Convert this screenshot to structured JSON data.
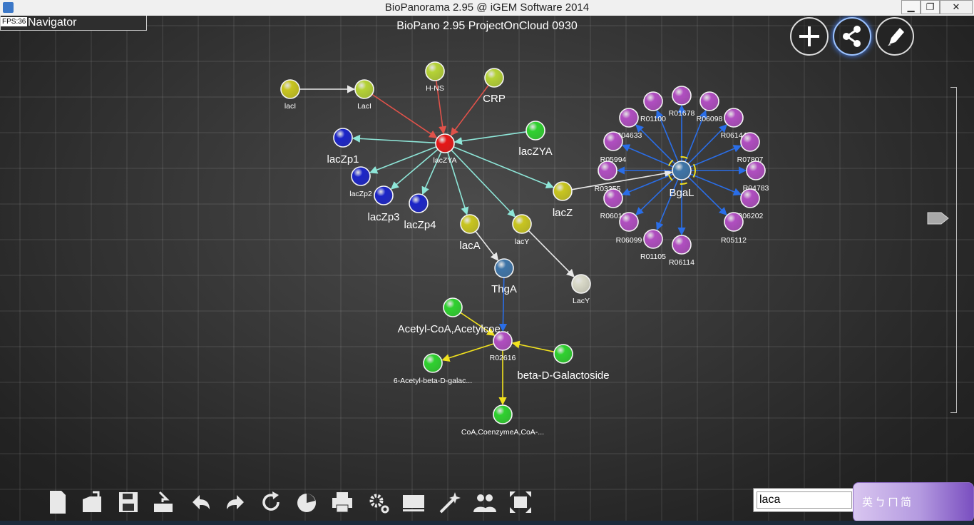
{
  "window": {
    "title": "BioPanorama 2.95 @ iGEM Software 2014",
    "minimize": "▁",
    "maximize": "❐",
    "close": "✕"
  },
  "navigator": {
    "label": "Navigator",
    "fps": "FPS:36"
  },
  "project": {
    "title": "BioPano 2.95 ProjectOnCloud 0930"
  },
  "top_buttons": [
    {
      "name": "add-button",
      "icon": "plus-icon"
    },
    {
      "name": "share-button",
      "icon": "share-icon"
    },
    {
      "name": "edit-button",
      "icon": "pencil-icon"
    }
  ],
  "colors": {
    "yellow_node": "#c8c520",
    "lime_node": "#b5d236",
    "green_node": "#2fd12f",
    "blue_node": "#1c25c8",
    "red_node": "#e61616",
    "purple_node": "#b04ec0",
    "steel_node": "#3f75a8",
    "white_node": "#d9d9c8",
    "red_edge": "#e0524a",
    "teal_edge": "#8ee6d8",
    "blue_edge": "#2a6ee8",
    "yellow_edge": "#f2e21e",
    "white_edge": "#e8e8e8"
  },
  "nodes": [
    {
      "id": "lacI_1",
      "label": "lacI",
      "color": "yellow"
    },
    {
      "id": "LacI",
      "label": "LacI",
      "color": "lime"
    },
    {
      "id": "HNS",
      "label": "H-NS",
      "color": "lime"
    },
    {
      "id": "CRP",
      "label": "CRP",
      "color": "lime"
    },
    {
      "id": "lacZp1",
      "label": "lacZp1",
      "color": "blue"
    },
    {
      "id": "lacZYA",
      "label": "lacZYA",
      "color": "red"
    },
    {
      "id": "lacZYA2",
      "label": "lacZYA",
      "color": "green"
    },
    {
      "id": "lacZp2",
      "label": "lacZp2",
      "color": "blue"
    },
    {
      "id": "lacZp3",
      "label": "lacZp3",
      "color": "blue"
    },
    {
      "id": "lacZp4",
      "label": "lacZp4",
      "color": "blue"
    },
    {
      "id": "lacA",
      "label": "lacA",
      "color": "yellow"
    },
    {
      "id": "lacY",
      "label": "lacY",
      "color": "yellow"
    },
    {
      "id": "lacZ",
      "label": "lacZ",
      "color": "yellow"
    },
    {
      "id": "ThgA",
      "label": "ThgA",
      "color": "steel"
    },
    {
      "id": "LacY2",
      "label": "LacY",
      "color": "white"
    },
    {
      "id": "acetylcoa",
      "label": "Acetyl-CoA,Acetylcoe...",
      "color": "green"
    },
    {
      "id": "R02616",
      "label": "R02616",
      "color": "purple"
    },
    {
      "id": "acetylgal",
      "label": "6-Acetyl-beta-D-galac...",
      "color": "green"
    },
    {
      "id": "bdgal",
      "label": "beta-D-Galactoside",
      "color": "green"
    },
    {
      "id": "coa",
      "label": "CoA,CoenzymeA,CoA-...",
      "color": "green"
    },
    {
      "id": "BgaL",
      "label": "BgaL",
      "color": "steel"
    },
    {
      "id": "R01678",
      "label": "R01678",
      "color": "purple"
    },
    {
      "id": "R01100",
      "label": "R01100",
      "color": "purple"
    },
    {
      "id": "R06098",
      "label": "R06098",
      "color": "purple"
    },
    {
      "id": "R04633",
      "label": "R04633",
      "color": "purple"
    },
    {
      "id": "R06144",
      "label": "R06144",
      "color": "purple"
    },
    {
      "id": "R05994",
      "label": "R05994",
      "color": "purple"
    },
    {
      "id": "R07807",
      "label": "R07807",
      "color": "purple"
    },
    {
      "id": "R03355",
      "label": "R03355",
      "color": "purple"
    },
    {
      "id": "R04783",
      "label": "R04783",
      "color": "purple"
    },
    {
      "id": "R06010",
      "label": "R06010",
      "color": "purple"
    },
    {
      "id": "R06202",
      "label": "R06202",
      "color": "purple"
    },
    {
      "id": "R06099",
      "label": "R06099",
      "color": "purple"
    },
    {
      "id": "R05112",
      "label": "R05112",
      "color": "purple"
    },
    {
      "id": "R01105",
      "label": "R01105",
      "color": "purple"
    },
    {
      "id": "R06114",
      "label": "R06114",
      "color": "purple"
    }
  ],
  "edges": [
    {
      "from": "lacI_1",
      "to": "LacI",
      "color": "white"
    },
    {
      "from": "LacI",
      "to": "lacZYA",
      "color": "red"
    },
    {
      "from": "HNS",
      "to": "lacZYA",
      "color": "red"
    },
    {
      "from": "CRP",
      "to": "lacZYA",
      "color": "red"
    },
    {
      "from": "lacZYA",
      "to": "lacZp1",
      "color": "teal"
    },
    {
      "from": "lacZYA2",
      "to": "lacZYA",
      "color": "teal"
    },
    {
      "from": "lacZYA",
      "to": "lacZp2",
      "color": "teal"
    },
    {
      "from": "lacZYA",
      "to": "lacZp3",
      "color": "teal"
    },
    {
      "from": "lacZYA",
      "to": "lacZp4",
      "color": "teal"
    },
    {
      "from": "lacZYA",
      "to": "lacA",
      "color": "teal"
    },
    {
      "from": "lacZYA",
      "to": "lacY",
      "color": "teal"
    },
    {
      "from": "lacZYA",
      "to": "lacZ",
      "color": "teal"
    },
    {
      "from": "lacZ",
      "to": "BgaL",
      "color": "white"
    },
    {
      "from": "lacA",
      "to": "ThgA",
      "color": "white"
    },
    {
      "from": "lacY",
      "to": "LacY2",
      "color": "white"
    },
    {
      "from": "ThgA",
      "to": "R02616",
      "color": "blue"
    },
    {
      "from": "acetylcoa",
      "to": "R02616",
      "color": "yellow"
    },
    {
      "from": "bdgal",
      "to": "R02616",
      "color": "yellow"
    },
    {
      "from": "R02616",
      "to": "acetylgal",
      "color": "yellow"
    },
    {
      "from": "R02616",
      "to": "coa",
      "color": "yellow"
    },
    {
      "from": "BgaL",
      "to": "R01678",
      "color": "blue"
    },
    {
      "from": "BgaL",
      "to": "R01100",
      "color": "blue"
    },
    {
      "from": "BgaL",
      "to": "R06098",
      "color": "blue"
    },
    {
      "from": "BgaL",
      "to": "R04633",
      "color": "blue"
    },
    {
      "from": "BgaL",
      "to": "R06144",
      "color": "blue"
    },
    {
      "from": "BgaL",
      "to": "R05994",
      "color": "blue"
    },
    {
      "from": "BgaL",
      "to": "R07807",
      "color": "blue"
    },
    {
      "from": "BgaL",
      "to": "R03355",
      "color": "blue"
    },
    {
      "from": "BgaL",
      "to": "R04783",
      "color": "blue"
    },
    {
      "from": "BgaL",
      "to": "R06010",
      "color": "blue"
    },
    {
      "from": "BgaL",
      "to": "R06202",
      "color": "blue"
    },
    {
      "from": "BgaL",
      "to": "R06099",
      "color": "blue"
    },
    {
      "from": "BgaL",
      "to": "R05112",
      "color": "blue"
    },
    {
      "from": "BgaL",
      "to": "R01105",
      "color": "blue"
    },
    {
      "from": "BgaL",
      "to": "R06114",
      "color": "blue"
    }
  ],
  "toolbar": [
    {
      "name": "new-file-button",
      "icon": "file-icon"
    },
    {
      "name": "open-button",
      "icon": "folder-open-icon"
    },
    {
      "name": "save-button",
      "icon": "save-icon"
    },
    {
      "name": "import-button",
      "icon": "import-icon"
    },
    {
      "name": "undo-button",
      "icon": "undo-icon"
    },
    {
      "name": "redo-button",
      "icon": "redo-icon"
    },
    {
      "name": "refresh-button",
      "icon": "refresh-icon"
    },
    {
      "name": "chart-button",
      "icon": "pie-chart-icon"
    },
    {
      "name": "print-button",
      "icon": "print-icon"
    },
    {
      "name": "settings-button",
      "icon": "gear-icon"
    },
    {
      "name": "book-button",
      "icon": "book-icon"
    },
    {
      "name": "magic-button",
      "icon": "magic-wand-icon"
    },
    {
      "name": "users-button",
      "icon": "users-icon"
    },
    {
      "name": "fit-screen-button",
      "icon": "fit-screen-icon"
    }
  ],
  "search": {
    "value": "laca"
  },
  "ime": {
    "label": "英ㄅㄇ简"
  }
}
